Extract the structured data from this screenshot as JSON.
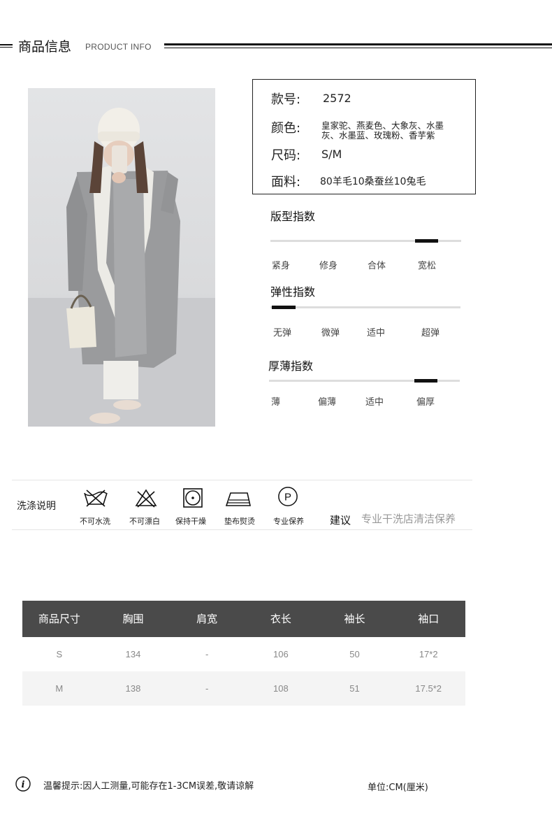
{
  "header": {
    "title": "商品信息",
    "subtitle": "PRODUCT INFO"
  },
  "product_photo": {
    "description": ""
  },
  "info": {
    "style_no_label": "款号:",
    "style_no": "2572",
    "color_label": "颜色:",
    "color_line1": "皇家驼、燕麦色、大象灰、水墨",
    "color_line2": "灰、水墨蓝、玫瑰粉、香芋紫",
    "size_label": "尺码:",
    "size": "S/M",
    "fabric_label": "面料:",
    "fabric": "80羊毛10桑蚕丝10兔毛"
  },
  "indexes": [
    {
      "title": "版型指数",
      "labels": [
        "紧身",
        "修身",
        "合体",
        "宽松"
      ],
      "selected": "宽松"
    },
    {
      "title": "弹性指数",
      "labels": [
        "无弹",
        "微弹",
        "适中",
        "超弹"
      ],
      "selected": "无弹"
    },
    {
      "title": "厚薄指数",
      "labels": [
        "薄",
        "偏薄",
        "适中",
        "偏厚"
      ],
      "selected": "偏厚"
    }
  ],
  "care": {
    "title": "洗涤说明",
    "items": [
      {
        "icon": "no-wash-icon",
        "label": "不可水洗"
      },
      {
        "icon": "no-bleach-icon",
        "label": "不可漂白"
      },
      {
        "icon": "tumble-dry-icon",
        "label": "保持干燥"
      },
      {
        "icon": "iron-icon",
        "label": "垫布熨烫"
      },
      {
        "icon": "professional-clean-icon",
        "label": "专业保养"
      }
    ],
    "suggest_label": "建议",
    "suggest_value": "专业干洗店清洁保养"
  },
  "size_table": {
    "headers": [
      "商品尺寸",
      "胸围",
      "肩宽",
      "衣长",
      "袖长",
      "袖口"
    ],
    "rows": [
      [
        "S",
        "134",
        "-",
        "106",
        "50",
        "17*2"
      ],
      [
        "M",
        "138",
        "-",
        "108",
        "51",
        "17.5*2"
      ]
    ]
  },
  "footer": {
    "note_icon": "info-icon",
    "note": "温馨提示:因人工测量,可能存在1-3CM误差,敬请谅解",
    "unit": "单位:CM(厘米)"
  }
}
